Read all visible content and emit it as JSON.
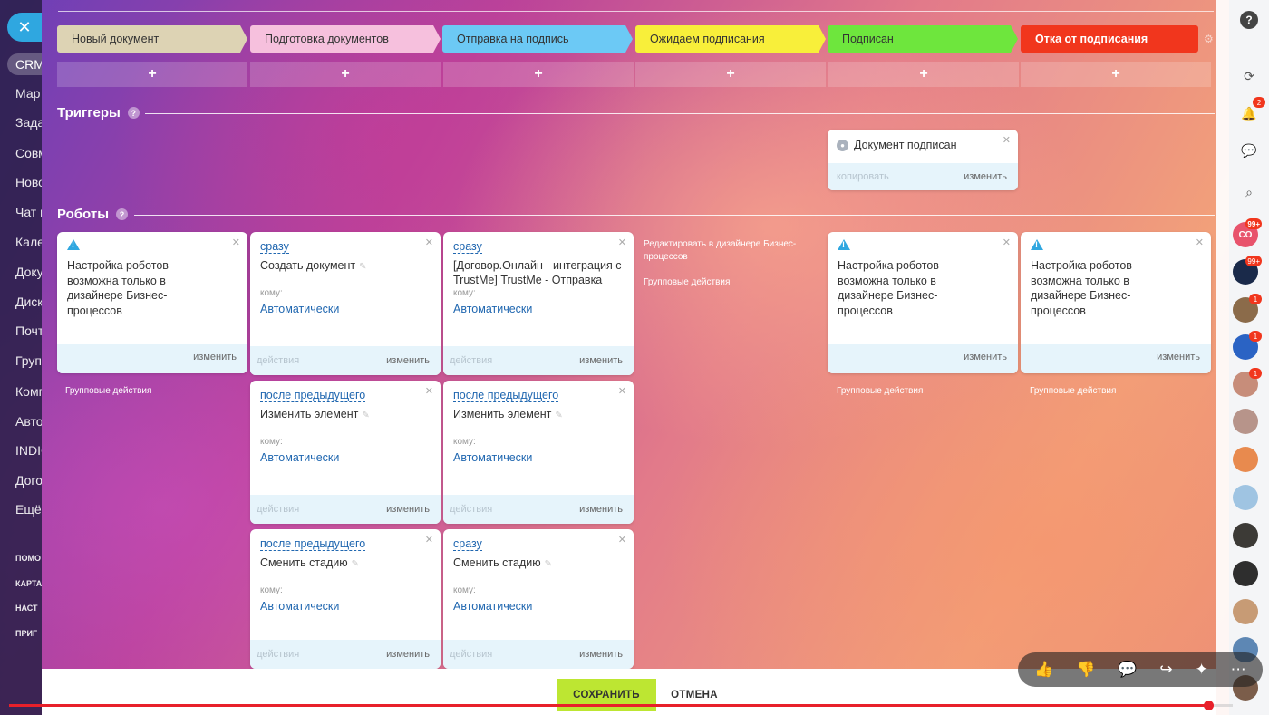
{
  "left_sidebar": {
    "close_glyph": "✕",
    "crm": "CRM",
    "items": [
      "Мар",
      "Зада",
      "Совм",
      "Ново",
      "Чат и",
      "Кале",
      "Доку",
      "Диск",
      "Почт",
      "Груп",
      "Комп",
      "Авто",
      "INDIC",
      "Дого",
      "Ещё"
    ],
    "bottom_items": [
      "ПОМО",
      "КАРТА",
      "НАСТ",
      "ПРИГ"
    ]
  },
  "stages": [
    {
      "label": "Новый документ",
      "color": "#ddd3b4"
    },
    {
      "label": "Подготовка документов",
      "color": "#f6c0dd"
    },
    {
      "label": "Отправка на подпись",
      "color": "#6cc9f5"
    },
    {
      "label": "Ожидаем подписания",
      "color": "#f8ef3a"
    },
    {
      "label": "Подписан",
      "color": "#6ee63d"
    },
    {
      "label": "Отка от подписания",
      "color": "#f1361d"
    }
  ],
  "add_button_label": "+",
  "triggers": {
    "title": "Триггеры",
    "card": {
      "title": "Документ подписан",
      "copy": "копировать",
      "edit": "изменить"
    }
  },
  "robots": {
    "title": "Роботы",
    "warning_text": "Настройка роботов возможна только в дизайнере Бизнес-процессов",
    "warning_edit": "изменить",
    "group_actions": "Групповые действия",
    "designer_link": "Редактировать в дизайнере Бизнес-процессов",
    "to_label": "кому:",
    "to_value": "Автоматически",
    "actions_label": "действия",
    "edit_label": "изменить",
    "col2": [
      {
        "when": "сразу",
        "name": "Создать документ"
      },
      {
        "when": "после предыдущего",
        "name": "Изменить элемент"
      },
      {
        "when": "после предыдущего",
        "name": "Сменить стадию"
      }
    ],
    "col3": [
      {
        "when": "сразу",
        "name": "[Договор.Онлайн - интеграция с TrustMe] TrustMe - Отправка"
      },
      {
        "when": "после предыдущего",
        "name": "Изменить элемент"
      },
      {
        "when": "сразу",
        "name": "Сменить стадию"
      }
    ]
  },
  "bottom": {
    "save": "СОХРАНИТЬ",
    "cancel": "ОТМЕНА"
  },
  "video": {
    "progress": 0.98,
    "buttons": [
      "👍",
      "👎",
      "💬",
      "↪",
      "✦",
      "⋯"
    ]
  },
  "right_panel": {
    "help": "?",
    "badges": [
      "2",
      "99+",
      "99+",
      "1",
      "1",
      "1"
    ],
    "avatar_text": "СО"
  }
}
